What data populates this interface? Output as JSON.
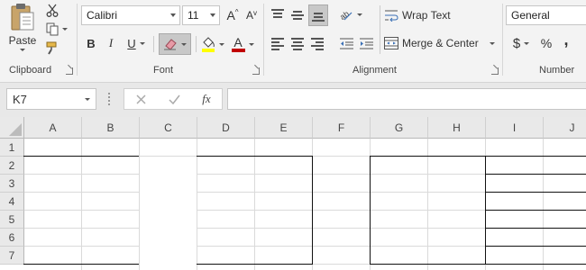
{
  "clipboard": {
    "paste_label": "Paste",
    "group_label": "Clipboard"
  },
  "font": {
    "name": "Calibri",
    "size": "11",
    "bold": "B",
    "italic": "I",
    "underline": "U",
    "grow": "A",
    "shrink": "A",
    "font_color_letter": "A",
    "group_label": "Font",
    "highlight_color": "#ffff00",
    "font_color": "#c00000"
  },
  "alignment": {
    "wrap_text_label": "Wrap Text",
    "merge_center_label": "Merge & Center",
    "group_label": "Alignment"
  },
  "number": {
    "format": "General",
    "currency": "$",
    "percent": "%",
    "comma": ",",
    "group_label": "Number"
  },
  "formula_bar": {
    "name_box": "K7",
    "fx": "fx",
    "content": ""
  },
  "sheet": {
    "columns": [
      "A",
      "B",
      "C",
      "D",
      "E",
      "F",
      "G",
      "H",
      "I",
      "J"
    ],
    "rows": [
      "1",
      "2",
      "3",
      "4",
      "5",
      "6",
      "7"
    ]
  }
}
